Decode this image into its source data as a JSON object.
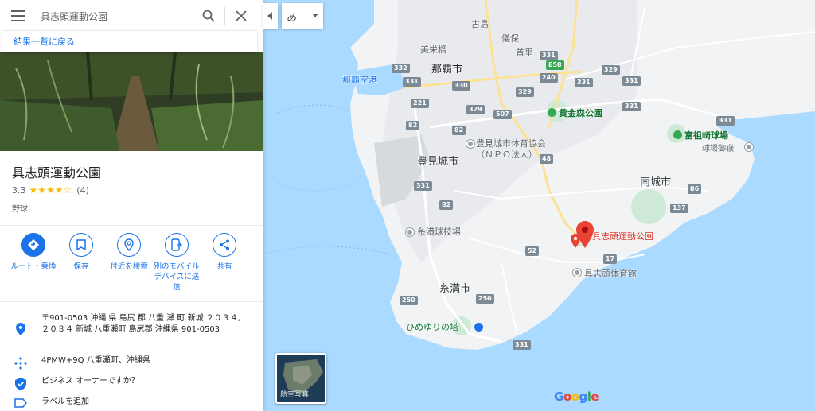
{
  "search": {
    "query": "具志頭運動公園"
  },
  "back_link": "結果一覧に戻る",
  "place": {
    "name": "具志頭運動公園",
    "rating": "3.3",
    "stars": "★★★★☆",
    "review_count": "(4)",
    "category": "野球"
  },
  "actions": [
    {
      "label": "ルート・乗換"
    },
    {
      "label": "保存"
    },
    {
      "label": "付近を検索"
    },
    {
      "label": "別のモバイルデバイスに送信"
    },
    {
      "label": "共有"
    }
  ],
  "info": {
    "address": "〒901-0503 沖縄 県 島尻 郡 八重 瀬 町 新城 ２０３４, ２０３４ 新城 八重瀬町 島尻郡 沖縄県 901-0503",
    "plus_code": "4PMW+9Q 八重瀬町、沖縄県",
    "business": "ビジネス オーナーですか？",
    "label": "ラベルを追加"
  },
  "map_controls": {
    "ime": "あ",
    "aerial_label": "航空写真",
    "logo": "Google"
  },
  "map_labels": {
    "naha": "那覇市",
    "furujima": "古島",
    "gibo": "儀保",
    "shuri": "首里",
    "mie": "美栄橋",
    "naha_airport": "那覇空港",
    "koganemori": "黄金森公園",
    "gym1": "豊見城市体育協会",
    "gym2": "（ＮＰＯ法人）",
    "tomigusuku": "豊見城市",
    "tomisaki": "富祖崎球場",
    "baseball_field": "球場御嶽",
    "nanjo": "南城市",
    "itoman_field": "糸満球技場",
    "itoman": "糸満市",
    "park": "具志頭運動公園",
    "gushikami_gym": "具志頭体育館",
    "himeyuri": "ひめゆりの塔"
  },
  "roads": [
    "332",
    "331",
    "330",
    "221",
    "82",
    "331",
    "329",
    "507",
    "331",
    "329",
    "82",
    "48",
    "331",
    "331",
    "82",
    "86",
    "137",
    "52",
    "17",
    "250",
    "250",
    "331",
    "329",
    "E58",
    "240",
    "331",
    "331"
  ]
}
